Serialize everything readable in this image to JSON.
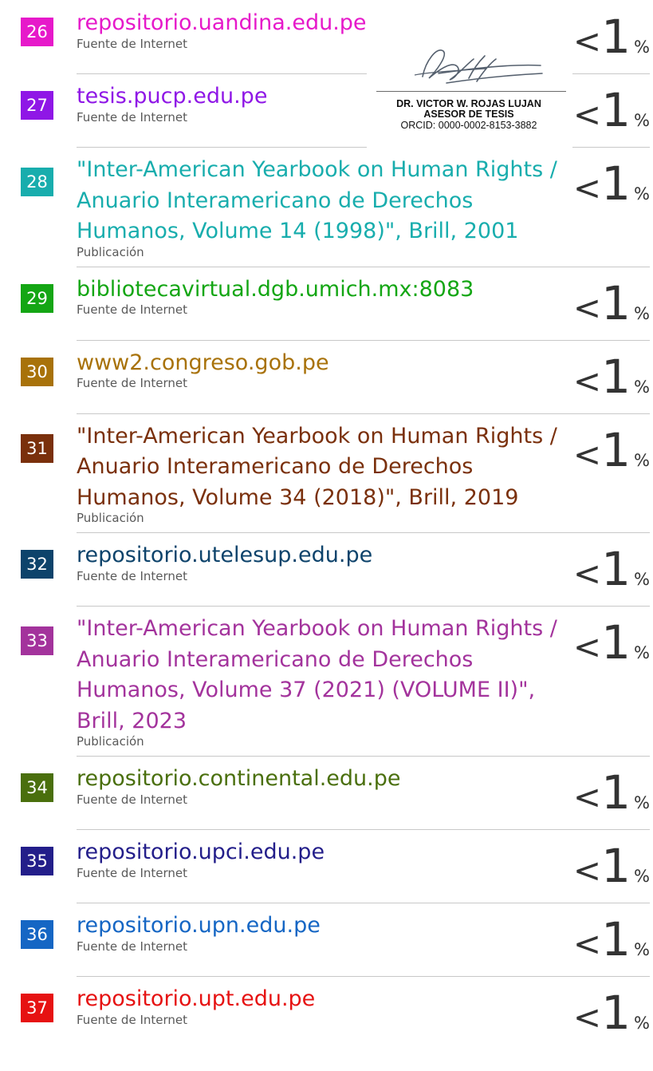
{
  "sources": [
    {
      "number": "26",
      "title": "repositorio.uandina.edu.pe",
      "type": "Fuente de Internet",
      "percent_prefix": "<",
      "percent_value": "1",
      "percent_sign": "%",
      "color": "#e619ca"
    },
    {
      "number": "27",
      "title": "tesis.pucp.edu.pe",
      "type": "Fuente de Internet",
      "percent_prefix": "<",
      "percent_value": "1",
      "percent_sign": "%",
      "color": "#8f17e6"
    },
    {
      "number": "28",
      "title": "\"Inter-American Yearbook on Human Rights / Anuario Interamericano de Derechos Humanos, Volume 14 (1998)\", Brill, 2001",
      "type": "Publicación",
      "percent_prefix": "<",
      "percent_value": "1",
      "percent_sign": "%",
      "color": "#18adad"
    },
    {
      "number": "29",
      "title": "bibliotecavirtual.dgb.umich.mx:8083",
      "type": "Fuente de Internet",
      "percent_prefix": "<",
      "percent_value": "1",
      "percent_sign": "%",
      "color": "#14a614"
    },
    {
      "number": "30",
      "title": "www2.congreso.gob.pe",
      "type": "Fuente de Internet",
      "percent_prefix": "<",
      "percent_value": "1",
      "percent_sign": "%",
      "color": "#a8720a"
    },
    {
      "number": "31",
      "title": "\"Inter-American Yearbook on Human Rights / Anuario Interamericano de Derechos Humanos, Volume 34 (2018)\", Brill, 2019",
      "type": "Publicación",
      "percent_prefix": "<",
      "percent_value": "1",
      "percent_sign": "%",
      "color": "#7a300c"
    },
    {
      "number": "32",
      "title": "repositorio.utelesup.edu.pe",
      "type": "Fuente de Internet",
      "percent_prefix": "<",
      "percent_value": "1",
      "percent_sign": "%",
      "color": "#0d436b"
    },
    {
      "number": "33",
      "title": "\"Inter-American Yearbook on Human Rights / Anuario Interamericano de Derechos Humanos, Volume 37 (2021) (VOLUME II)\", Brill, 2023",
      "type": "Publicación",
      "percent_prefix": "<",
      "percent_value": "1",
      "percent_sign": "%",
      "color": "#a3339c"
    },
    {
      "number": "34",
      "title": "repositorio.continental.edu.pe",
      "type": "Fuente de Internet",
      "percent_prefix": "<",
      "percent_value": "1",
      "percent_sign": "%",
      "color": "#4a6f0d"
    },
    {
      "number": "35",
      "title": "repositorio.upci.edu.pe",
      "type": "Fuente de Internet",
      "percent_prefix": "<",
      "percent_value": "1",
      "percent_sign": "%",
      "color": "#231e8a"
    },
    {
      "number": "36",
      "title": "repositorio.upn.edu.pe",
      "type": "Fuente de Internet",
      "percent_prefix": "<",
      "percent_value": "1",
      "percent_sign": "%",
      "color": "#1566c4"
    },
    {
      "number": "37",
      "title": "repositorio.upt.edu.pe",
      "type": "Fuente de Internet",
      "percent_prefix": "<",
      "percent_value": "1",
      "percent_sign": "%",
      "color": "#e61212"
    }
  ],
  "titles_wrapped": {
    "28": [
      "\"Inter-American Yearbook on Human Rights /",
      "Anuario Interamericano de Derechos",
      "Humanos, Volume 14 (1998)\", Brill, 2001"
    ],
    "31": [
      "\"Inter-American Yearbook on Human Rights /",
      "Anuario Interamericano de Derechos",
      "Humanos, Volume 34 (2018)\", Brill, 2019"
    ],
    "33": [
      "\"Inter-American Yearbook on Human Rights /",
      "Anuario Interamericano de Derechos",
      "Humanos, Volume 37 (2021) (VOLUME II)\",",
      "Brill, 2023"
    ]
  },
  "stamp": {
    "name": "DR. VICTOR W. ROJAS LUJAN",
    "role": "ASESOR DE TESIS",
    "orcid": "ORCID: 0000-0002-8153-3882"
  }
}
